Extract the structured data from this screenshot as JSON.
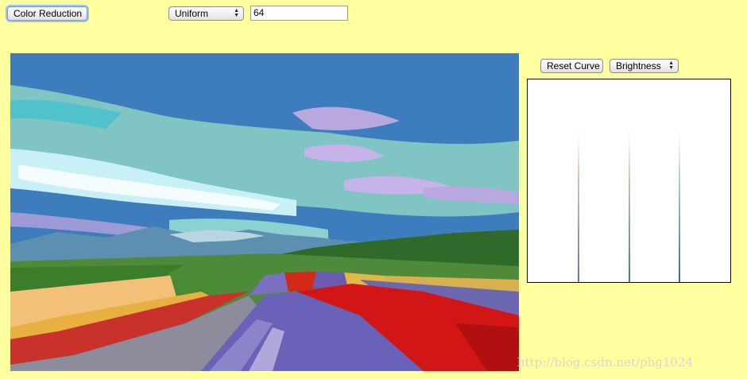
{
  "toolbar": {
    "color_reduction_label": "Color Reduction",
    "method_selected": "Uniform",
    "color_count_value": "64"
  },
  "curve_panel": {
    "reset_curve_label": "Reset Curve",
    "channel_selected": "Brightness"
  },
  "watermark": "http://blog.csdn.net/phg1024",
  "photo": {
    "content": "Posterized flower field landscape with blue sky and clouds"
  },
  "colors": {
    "background": "#ffff9f",
    "sky": "#3e7dbd",
    "red_flowers": "#d21616",
    "lavender": "#7a6fc0"
  }
}
